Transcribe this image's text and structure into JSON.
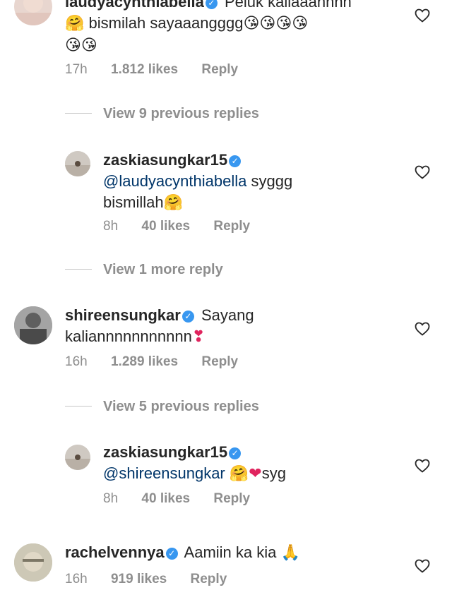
{
  "comments": [
    {
      "username": "laudyacynthiabella",
      "text": "Peluk kaliaaannnn",
      "line2": "bismilah sayaaangggg",
      "time": "17h",
      "likes": "1.812 likes",
      "reply": "Reply"
    },
    {
      "view_replies": "View 9 previous replies"
    },
    {
      "username": "zaskiasungkar15",
      "mention": "@laudyacynthiabella",
      "text": " syggg",
      "line2": "bismillah",
      "time": "8h",
      "likes": "40 likes",
      "reply": "Reply"
    },
    {
      "view_replies": "View 1 more reply"
    },
    {
      "username": "shireensungkar",
      "text": "Sayang",
      "line2": "kaliannnnnnnnnnn",
      "time": "16h",
      "likes": "1.289 likes",
      "reply": "Reply"
    },
    {
      "view_replies": "View 5 previous replies"
    },
    {
      "username": "zaskiasungkar15",
      "mention": "@shireensungkar",
      "text": "syg",
      "time": "8h",
      "likes": "40 likes",
      "reply": "Reply"
    },
    {
      "username": "rachelvennya",
      "text": "Aamiin ka kia",
      "time": "16h",
      "likes": "919 likes",
      "reply": "Reply"
    }
  ],
  "colors": {
    "text": "#262626",
    "meta": "#8e8e8e",
    "mention": "#003569",
    "verified": "#3897f0"
  },
  "icons": [
    "heart-outline-icon",
    "verified-badge-icon"
  ]
}
